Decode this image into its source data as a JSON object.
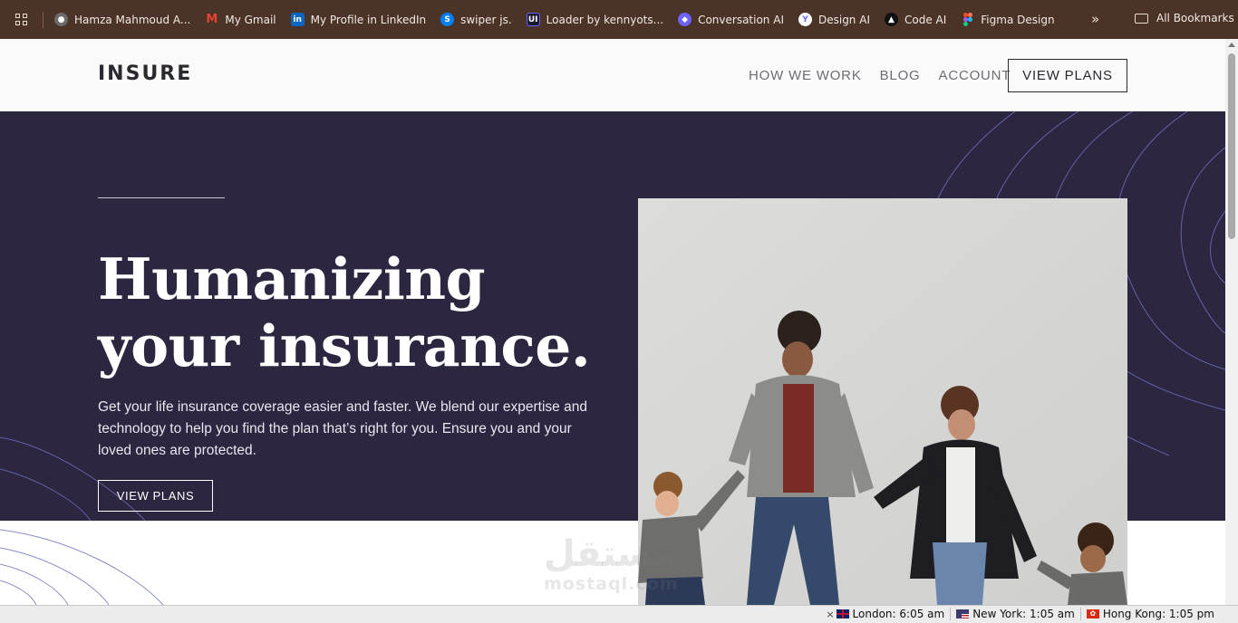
{
  "bookmarks_bar": {
    "apps_icon": "apps-grid-icon",
    "items": [
      {
        "label": "Hamza Mahmoud A...",
        "icon": "avatar-icon",
        "color": "#6b6b6b"
      },
      {
        "label": "My Gmail",
        "icon": "gmail-icon",
        "color": "#ea4335"
      },
      {
        "label": "My Profile in LinkedIn",
        "icon": "linkedin-icon",
        "color": "#0a66c2"
      },
      {
        "label": "swiper js.",
        "icon": "swiper-icon",
        "color": "#0080ff"
      },
      {
        "label": "Loader by kennyots...",
        "icon": "uiverse-icon",
        "color": "#1a1a2e"
      },
      {
        "label": "Conversation AI",
        "icon": "conversation-ai-icon",
        "color": "#6c63ff"
      },
      {
        "label": "Design AI",
        "icon": "design-ai-icon",
        "color": "#ffffff"
      },
      {
        "label": "Code AI",
        "icon": "code-ai-icon",
        "color": "#111111"
      },
      {
        "label": "Figma Design",
        "icon": "figma-icon",
        "color": "#f24e1e"
      }
    ],
    "more": "»",
    "all_bookmarks": "All Bookmarks"
  },
  "header": {
    "logo": "INSURE",
    "nav": [
      "HOW WE WORK",
      "BLOG",
      "ACCOUNT"
    ],
    "cta": "VIEW PLANS"
  },
  "hero": {
    "title_line1": "Humanizing",
    "title_line2": "your insurance.",
    "text": "Get your life insurance coverage easier and faster. We blend our expertise and technology to help you find the plan that’s right for you. Ensure you and your loved ones are protected.",
    "button": "VIEW PLANS",
    "photo_alt": "family-holding-hands-photo"
  },
  "watermark": {
    "arabic": "مستقل",
    "latin": "mostaql.com"
  },
  "status_bar": {
    "clocks": [
      {
        "label": "London: 6:05 am",
        "flag": "uk-flag-icon"
      },
      {
        "label": "New York: 1:05 am",
        "flag": "us-flag-icon"
      },
      {
        "label": "Hong Kong: 1:05 pm",
        "flag": "hk-flag-icon"
      }
    ]
  },
  "colors": {
    "hero_bg": "#2c2640",
    "bookmarks_bg": "#4b3327",
    "accent_line": "#6c6fb8"
  }
}
